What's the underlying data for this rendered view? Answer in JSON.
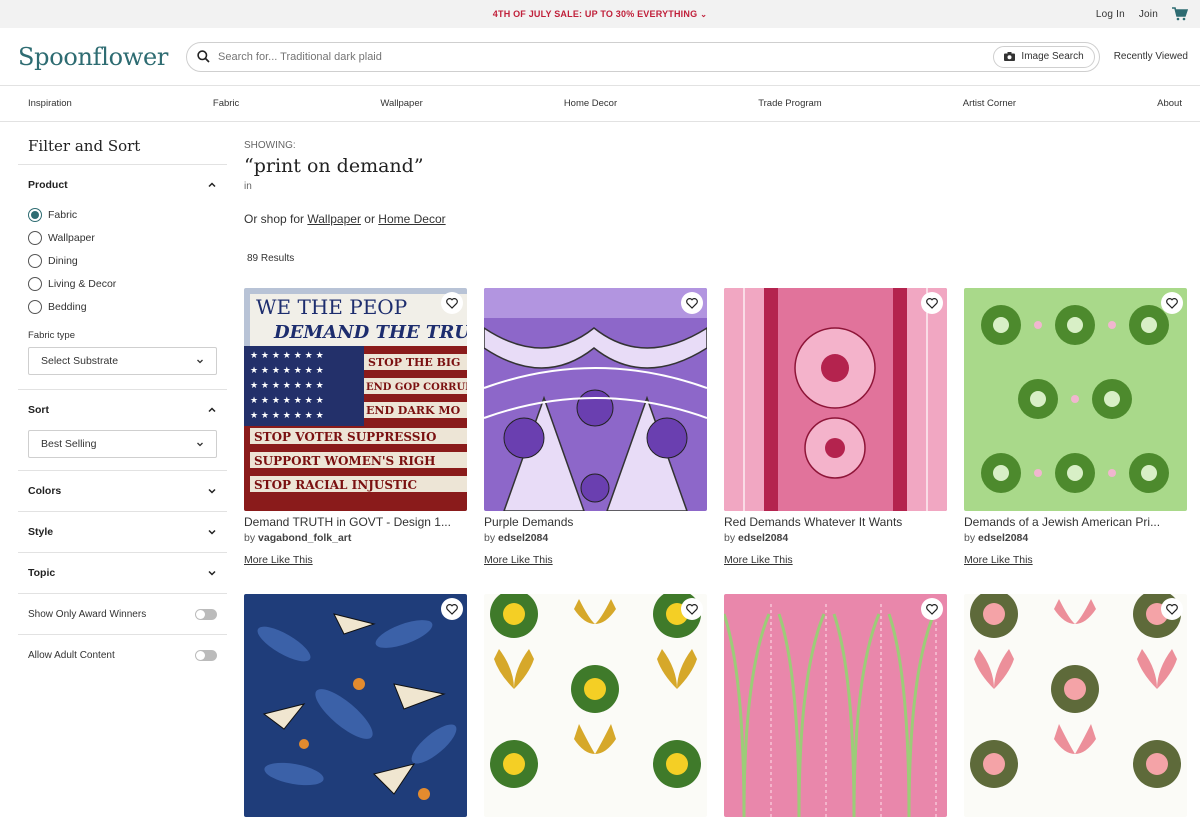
{
  "promo": {
    "text": "4TH OF JULY SALE: UP TO 30% EVERYTHING",
    "chevron": "⌄"
  },
  "account": {
    "login": "Log In",
    "join": "Join",
    "cart_icon": "cart-icon"
  },
  "header": {
    "logo": "Spoonflower",
    "search_placeholder": "Search for... Traditional dark plaid",
    "image_search": "Image Search",
    "recently_viewed": "Recently Viewed"
  },
  "nav": [
    "Inspiration",
    "Fabric",
    "Wallpaper",
    "Home Decor",
    "Trade Program",
    "Artist Corner",
    "About"
  ],
  "sidebar": {
    "title": "Filter and Sort",
    "product": {
      "label": "Product",
      "options": [
        "Fabric",
        "Wallpaper",
        "Dining",
        "Living & Decor",
        "Bedding"
      ],
      "selected": "Fabric",
      "fabric_type_label": "Fabric type",
      "fabric_type_value": "Select Substrate"
    },
    "sort": {
      "label": "Sort",
      "value": "Best Selling"
    },
    "colors": "Colors",
    "style": "Style",
    "topic": "Topic",
    "award_toggle": "Show Only Award Winners",
    "adult_toggle": "Allow Adult Content"
  },
  "main": {
    "showing": "SHOWING:",
    "query": "“print on demand”",
    "in": "in",
    "shop_prefix": "Or shop for ",
    "shop_wallpaper": "Wallpaper",
    "shop_or": " or ",
    "shop_home_decor": "Home Decor",
    "results": "89 Results"
  },
  "products": [
    {
      "title": "Demand TRUTH in GOVT - Design 1...",
      "by": "by",
      "artist": "vagabond_folk_art",
      "more": "More Like This"
    },
    {
      "title": "Purple Demands",
      "by": "by",
      "artist": "edsel2084",
      "more": "More Like This"
    },
    {
      "title": "Red Demands Whatever It Wants",
      "by": "by",
      "artist": "edsel2084",
      "more": "More Like This"
    },
    {
      "title": "Demands of a Jewish American Pri...",
      "by": "by",
      "artist": "edsel2084",
      "more": "More Like This"
    },
    {
      "title": "",
      "by": "",
      "artist": "",
      "more": ""
    },
    {
      "title": "",
      "by": "",
      "artist": "",
      "more": ""
    },
    {
      "title": "",
      "by": "",
      "artist": "",
      "more": ""
    },
    {
      "title": "",
      "by": "",
      "artist": "",
      "more": ""
    }
  ],
  "artwork_text": {
    "line1": "WE THE PEOP",
    "line2": "DEMAND THE TRUTH",
    "line3": "STOP THE BIG",
    "line4": "END GOP CORRUP",
    "line5": "END DARK MO",
    "line6": "STOP VOTER SUPPRESSIO",
    "line7": "SUPPORT WOMEN'S RIGH",
    "line8": "STOP RACIAL INJUSTIC"
  },
  "colors": {
    "brand": "#2e6c72",
    "promo_text": "#c0203a"
  }
}
